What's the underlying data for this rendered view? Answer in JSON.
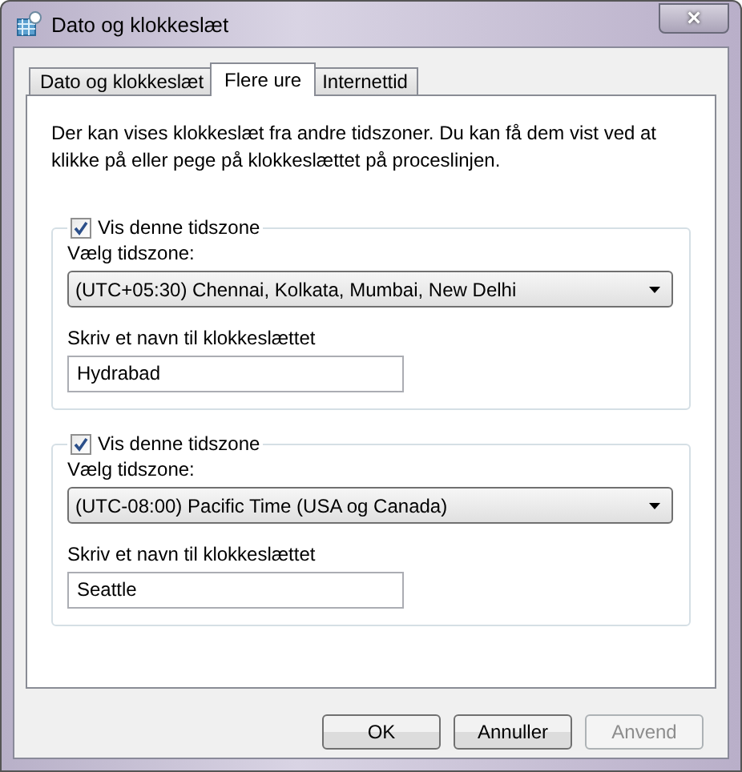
{
  "window": {
    "title": "Dato og klokkeslæt",
    "close": "×"
  },
  "tabs": [
    {
      "label": "Dato og klokkeslæt",
      "selected": false
    },
    {
      "label": "Flere ure",
      "selected": true
    },
    {
      "label": "Internettid",
      "selected": false
    }
  ],
  "description": "Der kan vises klokkeslæt fra andre tidszoner. Du kan få dem vist ved at klikke på eller pege på klokkeslættet på proceslinjen.",
  "clocks": [
    {
      "show_label": "Vis denne tidszone",
      "checked": true,
      "zone_label": "Vælg tidszone:",
      "zone": "(UTC+05:30) Chennai, Kolkata, Mumbai, New Delhi",
      "name_label": "Skriv et navn til klokkeslættet",
      "name": "Hydrabad"
    },
    {
      "show_label": "Vis denne tidszone",
      "checked": true,
      "zone_label": "Vælg tidszone:",
      "zone": "(UTC-08:00) Pacific Time (USA og Canada)",
      "name_label": "Skriv et navn til klokkeslættet",
      "name": "Seattle"
    }
  ],
  "buttons": [
    {
      "label": "OK",
      "disabled": false
    },
    {
      "label": "Annuller",
      "disabled": false
    },
    {
      "label": "Anvend",
      "disabled": true
    }
  ]
}
